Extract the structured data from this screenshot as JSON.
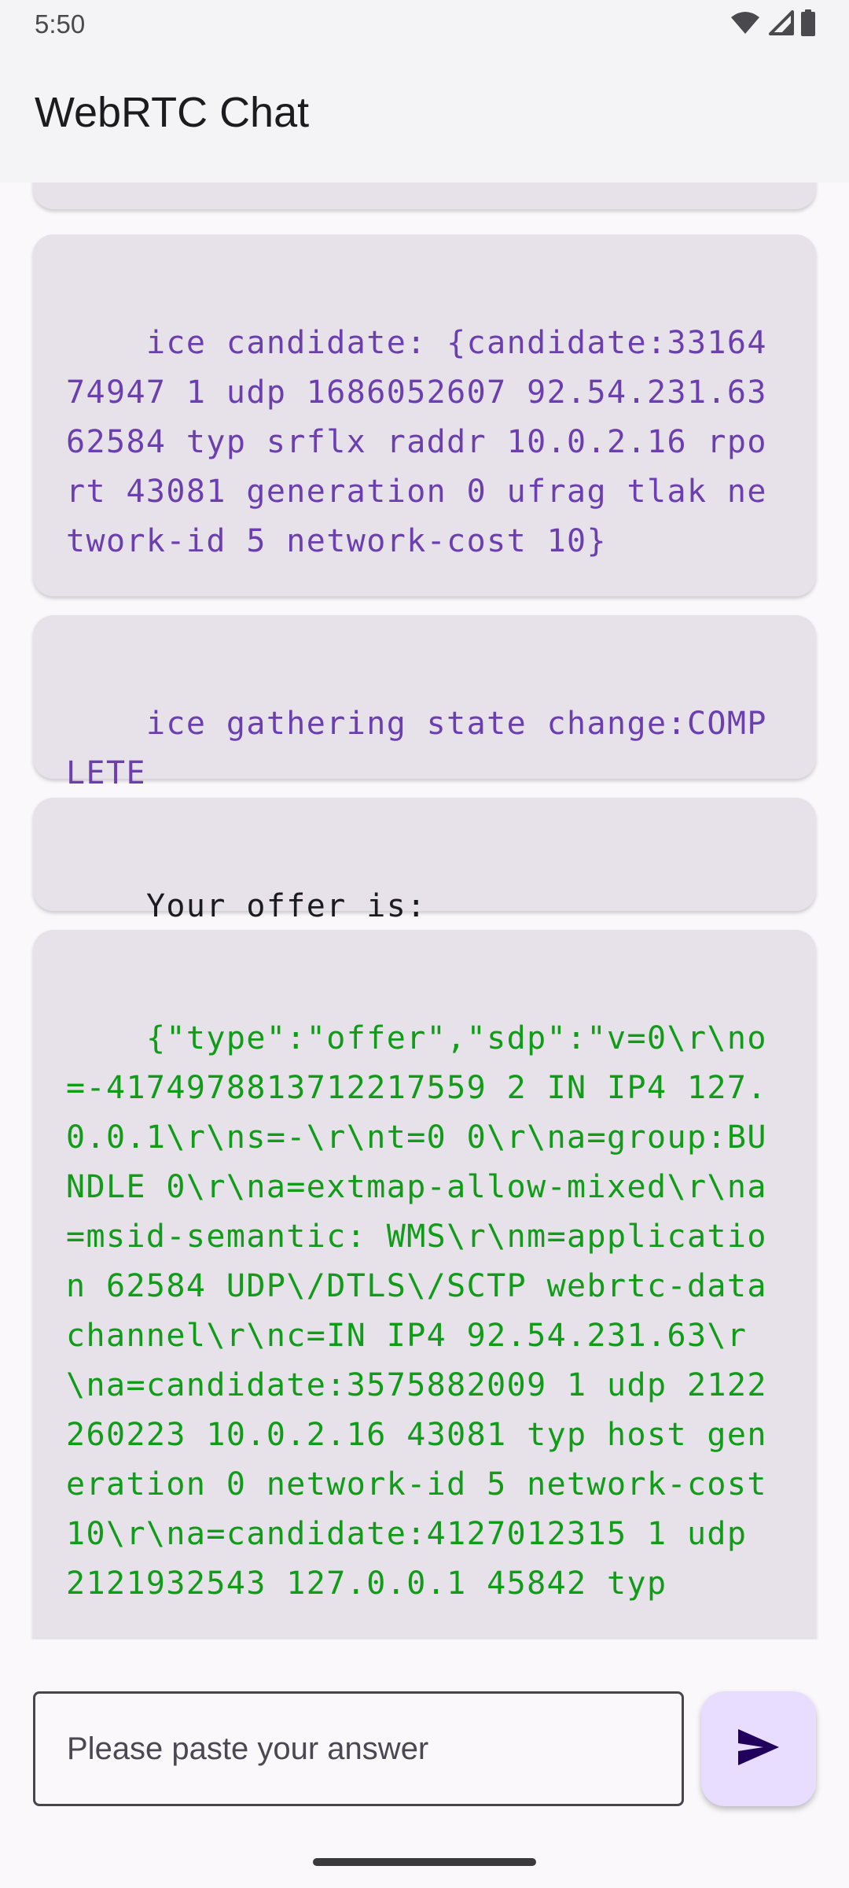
{
  "status_bar": {
    "time": "5:50",
    "icons": [
      "wifi-icon",
      "cell-signal-icon",
      "battery-icon"
    ]
  },
  "app_bar": {
    "title": "WebRTC Chat"
  },
  "messages": [
    {
      "id": "partial",
      "text": "",
      "color": "purple"
    },
    {
      "id": "ice-candidate",
      "text": "ice candidate: {candidate:3316474947 1 udp 1686052607 92.54.231.63 62584 typ srflx raddr 10.0.2.16 rport 43081 generation 0 ufrag tlak network-id 5 network-cost 10}",
      "color": "purple"
    },
    {
      "id": "ice-gathering",
      "text": "ice gathering state change:COMPLETE",
      "color": "purple"
    },
    {
      "id": "offer-label",
      "text": "Your offer is:",
      "color": "black"
    },
    {
      "id": "offer-json",
      "text": "{\"type\":\"offer\",\"sdp\":\"v=0\\r\\no=-4174978813712217559 2 IN IP4 127.0.0.1\\r\\ns=-\\r\\nt=0 0\\r\\na=group:BUNDLE 0\\r\\na=extmap-allow-mixed\\r\\na=msid-semantic: WMS\\r\\nm=application 62584 UDP\\/DTLS\\/SCTP webrtc-datachannel\\r\\nc=IN IP4 92.54.231.63\\r\\na=candidate:3575882009 1 udp 2122260223 10.0.2.16 43081 typ host generation 0 network-id 5 network-cost 10\\r\\na=candidate:4127012315 1 udp 2121932543 127.0.0.1 45842 typ",
      "color": "green"
    }
  ],
  "composer": {
    "placeholder": "Please paste your answer",
    "value": "",
    "send_icon": "send-icon"
  },
  "colors": {
    "event_text": "#6b3fb0",
    "offer_text": "#109b18",
    "bubble_bg": "#e7e2e9",
    "send_button_bg": "#e9ddff",
    "send_icon": "#21005d"
  }
}
